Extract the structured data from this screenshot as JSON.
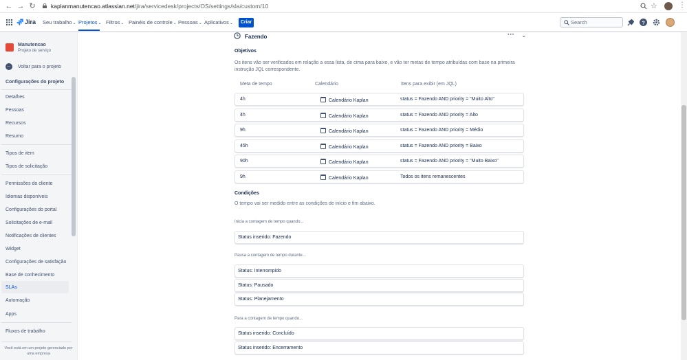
{
  "browser": {
    "url_domain": "kaplanmanutencao.atlassian.net",
    "url_path": "/jira/servicedesk/projects/OS/settings/sla/custom/10"
  },
  "topnav": {
    "logo": "Jira",
    "items": [
      "Seu trabalho",
      "Projetos",
      "Filtros",
      "Painéis de controle",
      "Pessoas",
      "Aplicativos"
    ],
    "create": "Criar",
    "search_placeholder": "Search"
  },
  "sidebar": {
    "project_name": "Manutencao",
    "project_type": "Projeto de serviço",
    "back": "Voltar para o projeto",
    "header": "Configurações do projeto",
    "items": [
      "Detalhes",
      "Pessoas",
      "Recursos",
      "Resumo",
      "Tipos de item",
      "Tipos de solicitação",
      "Permissões do cliente",
      "Idiomas disponíveis",
      "Configurações do portal",
      "Solicitações de e-mail",
      "Notificações de clientes",
      "Widget",
      "Configurações de satisfação",
      "Base de conhecimento",
      "SLAs",
      "Automação",
      "Apps",
      "Fluxos de trabalho"
    ],
    "footer": "Você está em um projeto gerenciado por uma empresa"
  },
  "goal": {
    "title": "Fazendo",
    "objectives_title": "Objetivos",
    "objectives_text": "Os itens vão ser verificados em relação a essa lista, de cima para baixo, e vão ter metas de tempo atribuídas com base na primeira instrução JQL correspondente.",
    "columns": [
      "Meta de tempo",
      "Calendário",
      "Itens para exibir (em JQL)"
    ],
    "rows": [
      {
        "time": "4h",
        "calendar": "Calendário Kaplan",
        "jql": "status = Fazendo AND priority = \"Muito Alto\""
      },
      {
        "time": "4h",
        "calendar": "Calendário Kaplan",
        "jql": "status = Fazendo AND priority = Alto"
      },
      {
        "time": "9h",
        "calendar": "Calendário Kaplan",
        "jql": "status = Fazendo AND priority = Médio"
      },
      {
        "time": "45h",
        "calendar": "Calendário Kaplan",
        "jql": "status = Fazendo AND priority = Baixo"
      },
      {
        "time": "90h",
        "calendar": "Calendário Kaplan",
        "jql": "status = Fazendo AND priority = \"Muito Baixo\""
      },
      {
        "time": "9h",
        "calendar": "Calendário Kaplan",
        "jql": "Todos os itens remanescentes"
      }
    ]
  },
  "conditions": {
    "title": "Condições",
    "text": "O tempo vai ser medido entre as condições de início e fim abaixo.",
    "start_label": "Inicia a contagem de tempo quando...",
    "start": [
      "Status inserido: Fazendo"
    ],
    "pause_label": "Pausa a contagem de tempo durante...",
    "pause": [
      "Status: Interrompido",
      "Status: Pausado",
      "Status: Planejamento"
    ],
    "stop_label": "Para a contagem de tempo quando...",
    "stop": [
      "Status inserido: Concluído",
      "Status inserido: Encerramento"
    ]
  },
  "colors": {
    "brand": "#0052cc",
    "text": "#172b4d",
    "subtle": "#5e6c84"
  }
}
